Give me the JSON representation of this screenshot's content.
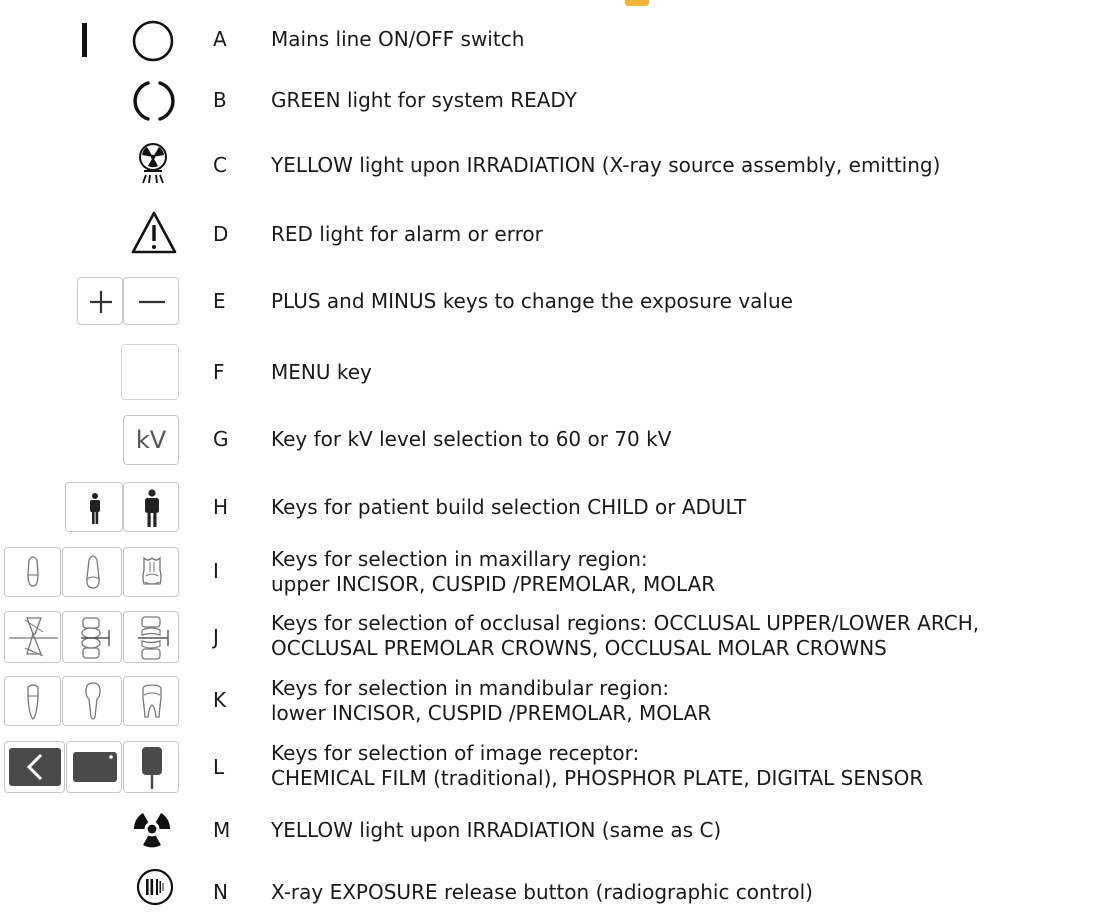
{
  "rows": [
    {
      "letter": "A",
      "desc": [
        "Mains line ON/OFF switch"
      ]
    },
    {
      "letter": "B",
      "desc": [
        "GREEN light for system READY"
      ]
    },
    {
      "letter": "C",
      "desc": [
        "YELLOW light upon IRRADIATION (X-ray source assembly, emitting)"
      ]
    },
    {
      "letter": "D",
      "desc": [
        "RED light for alarm or error"
      ]
    },
    {
      "letter": "E",
      "desc": [
        "PLUS and MINUS keys to change the exposure value"
      ]
    },
    {
      "letter": "F",
      "desc": [
        "MENU key"
      ]
    },
    {
      "letter": "G",
      "desc": [
        "Key for kV level selection to 60 or 70 kV"
      ]
    },
    {
      "letter": "H",
      "desc": [
        "Keys for patient build selection CHILD or ADULT"
      ]
    },
    {
      "letter": "I",
      "desc": [
        "Keys for selection in maxillary region:",
        "upper INCISOR, CUSPID /PREMOLAR, MOLAR"
      ]
    },
    {
      "letter": "J",
      "desc": [
        "Keys for selection of occlusal regions: OCCLUSAL UPPER/LOWER ARCH,",
        "OCCLUSAL PREMOLAR CROWNS, OCCLUSAL MOLAR CROWNS"
      ]
    },
    {
      "letter": "K",
      "desc": [
        "Keys for selection in mandibular region:",
        "lower INCISOR, CUSPID /PREMOLAR, MOLAR"
      ]
    },
    {
      "letter": "L",
      "desc": [
        "Keys for selection of image receptor:",
        "CHEMICAL FILM (traditional), PHOSPHOR PLATE, DIGITAL SENSOR"
      ]
    },
    {
      "letter": "M",
      "desc": [
        "YELLOW light upon IRRADIATION (same as C)"
      ]
    },
    {
      "letter": "N",
      "desc": [
        "X-ray EXPOSURE release button (radiographic control)"
      ]
    }
  ],
  "keys": {
    "kv_label": "kV"
  },
  "icons": {
    "A": [
      "power-line-icon",
      "power-circle-icon"
    ],
    "B": [
      "ready-light-icon"
    ],
    "C": [
      "radiation-source-icon"
    ],
    "D": [
      "warning-triangle-icon"
    ],
    "E": [
      "plus-icon",
      "minus-icon"
    ],
    "F": [
      "menu-key"
    ],
    "G": [
      "kv-key"
    ],
    "H": [
      "child-icon",
      "adult-icon"
    ],
    "I": [
      "upper-incisor-icon",
      "upper-premolar-icon",
      "upper-molar-icon"
    ],
    "J": [
      "occlusal-arch-icon",
      "occlusal-premolar-icon",
      "occlusal-molar-icon"
    ],
    "K": [
      "lower-incisor-icon",
      "lower-premolar-icon",
      "lower-molar-icon"
    ],
    "L": [
      "chemical-film-icon",
      "phosphor-plate-icon",
      "digital-sensor-icon"
    ],
    "M": [
      "radiation-trefoil-icon"
    ],
    "N": [
      "exposure-button-icon"
    ]
  }
}
